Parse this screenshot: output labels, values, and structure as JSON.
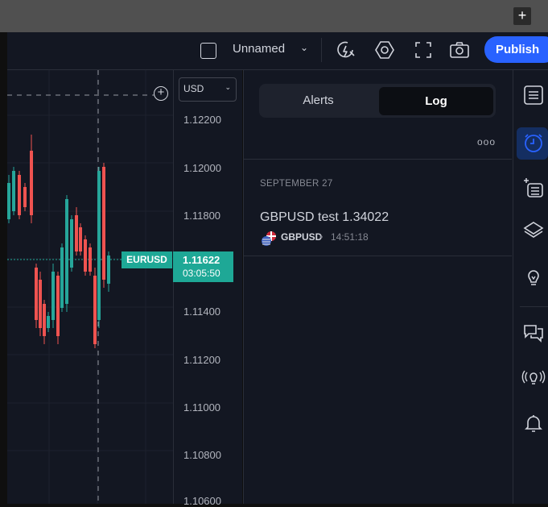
{
  "topbar": {
    "plus_label": "+"
  },
  "toolbar": {
    "layout_name": "Unnamed",
    "publish_label": "Publish"
  },
  "chart": {
    "currency": "USD",
    "symbol_tag": "EURUSD",
    "current_price": "1.11622",
    "countdown": "03:05:50",
    "price_ticks": [
      "1.12200",
      "1.12000",
      "1.11800",
      "1.11400",
      "1.11200",
      "1.11000",
      "1.10800",
      "1.10600"
    ],
    "colors": {
      "up": "#26a69a",
      "down": "#ef5350",
      "price_tag": "#1ea896"
    }
  },
  "alerts_panel": {
    "tabs": [
      {
        "label": "Alerts",
        "active": false
      },
      {
        "label": "Log",
        "active": true
      }
    ],
    "more_label": "ooo",
    "log_groups": [
      {
        "date": "SEPTEMBER 27",
        "entries": [
          {
            "title": "GBPUSD test 1.34022",
            "symbol": "GBPUSD",
            "separator": "•",
            "time": "14:51:18"
          }
        ]
      }
    ]
  },
  "sidebar": {
    "icons": [
      "watchlist-icon",
      "alert-clock-icon",
      "add-list-icon",
      "layers-icon",
      "ideas-bulb-icon",
      "chat-icon",
      "streams-icon",
      "notifications-bell-icon"
    ],
    "active": "alert-clock-icon",
    "accent": "#2962ff"
  }
}
